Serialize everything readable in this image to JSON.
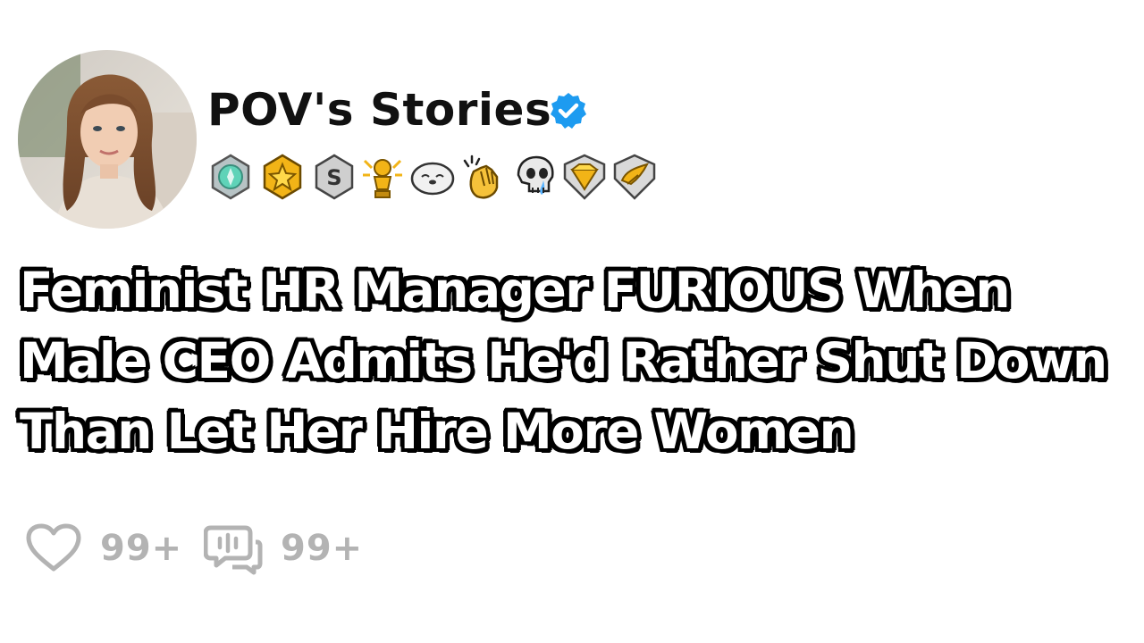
{
  "post": {
    "username": "POV's Stories",
    "verified": true,
    "title_lines": [
      "Feminist HR Manager FURIOUS When",
      "Male CEO Admits He'd Rather Shut Down",
      "Than Let Her Hire More Women"
    ],
    "awards": [
      "gem-shield-award-icon",
      "gold-star-award-icon",
      "silver-s-award-icon",
      "golden-trophy-snoo-award-icon",
      "seal-award-icon",
      "clapping-hands-award-icon",
      "crying-skull-award-icon",
      "gold-diamond-award-icon",
      "silver-wing-award-icon"
    ],
    "likes": "99+",
    "comments": "99+"
  },
  "colors": {
    "verified_blue": "#1d9bf0",
    "action_gray": "#b3b3b3",
    "title_fill": "#ffffff",
    "title_outline": "#000000"
  }
}
